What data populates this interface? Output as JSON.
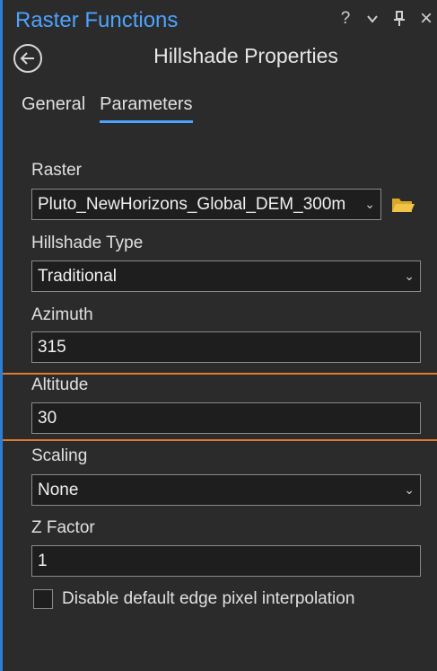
{
  "titlebar": {
    "title": "Raster Functions",
    "help_icon": "?",
    "menu_icon": "chevron-down",
    "pin_icon": "pin",
    "close_icon": "×"
  },
  "header": {
    "title": "Hillshade Properties"
  },
  "tabs": [
    {
      "label": "General"
    },
    {
      "label": "Parameters"
    }
  ],
  "form": {
    "raster": {
      "label": "Raster",
      "value": "Pluto_NewHorizons_Global_DEM_300m"
    },
    "hillshade_type": {
      "label": "Hillshade Type",
      "value": "Traditional"
    },
    "azimuth": {
      "label": "Azimuth",
      "value": "315"
    },
    "altitude": {
      "label": "Altitude",
      "value": "30"
    },
    "scaling": {
      "label": "Scaling",
      "value": "None"
    },
    "z_factor": {
      "label": "Z Factor",
      "value": "1"
    },
    "edge_interpolation": {
      "label": "Disable default edge pixel interpolation"
    }
  },
  "colors": {
    "accent": "#4da3ff",
    "highlight": "#e07a2f",
    "background": "#2b2b2b"
  }
}
